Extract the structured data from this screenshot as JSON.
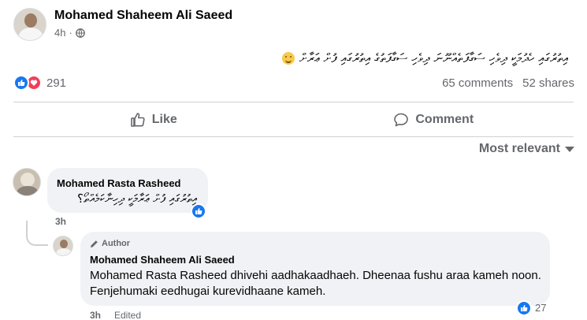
{
  "post": {
    "author": "Mohamed Shaheem Ali Saeed",
    "time": "4h",
    "separator": "·",
    "text": "އިތުރުގައި ހެދުމަކީ ދިވެހި ސަގާފަތެއްނޫނަ ދިވެހި ސަގާފަތުގެ އިތުރުގައި ފުށް ޢަރާށް",
    "reactions_count": "291",
    "comments_label": "65 comments",
    "shares_label": "52 shares"
  },
  "actions": {
    "like_label": "Like",
    "comment_label": "Comment"
  },
  "sort": {
    "label": "Most relevant"
  },
  "comments": [
    {
      "author": "Mohamed Rasta Rasheed",
      "text": "އިތުރުގައި ފުށް ޢަރާމަކީ ދިހިނާކަމެއްތޯ؟",
      "time": "3h"
    },
    {
      "badge": "Author",
      "author": "Mohamed Shaheem Ali Saeed",
      "text": "Mohamed Rasta Rasheed dhivehi aadhakaadhaeh. Dheenaa fushu araa kameh noon. Fenjehumaki eedhugai kurevidhaane kameh.",
      "likes": "27",
      "time": "3h",
      "edited": "Edited"
    }
  ],
  "colors": {
    "like_blue": "#1877f2",
    "love_red": "#f33e58",
    "secondary_text": "#65676b",
    "bubble_bg": "#f0f2f5"
  }
}
